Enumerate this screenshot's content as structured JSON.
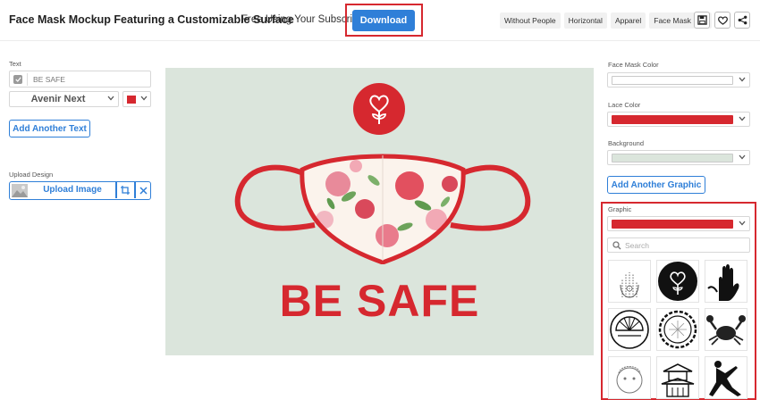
{
  "header": {
    "title": "Face Mask Mockup Featuring a Customizable Surface",
    "free_text": "Free Using Your Subscription!",
    "download_label": "Download",
    "tags": [
      "Without People",
      "Horizontal",
      "Apparel",
      "Face Mask"
    ],
    "icons": [
      "save-icon",
      "heart-icon",
      "share-icon"
    ]
  },
  "left_panel": {
    "text_label": "Text",
    "text_value": "BE SAFE",
    "font": "Avenir Next",
    "text_color": "#d6282f",
    "add_text_label": "Add Another Text",
    "upload_label": "Upload Design",
    "upload_button_label": "Upload Image"
  },
  "canvas": {
    "headline": "BE SAFE",
    "background_color": "#dbe5dc",
    "accent_color": "#d6282f"
  },
  "right_panel": {
    "mask_color_label": "Face Mask Color",
    "mask_color": "#ffffff",
    "lace_color_label": "Lace Color",
    "lace_color": "#d6282f",
    "background_label": "Background",
    "background_color": "#dbe5dc",
    "add_graphic_label": "Add Another Graphic",
    "graphic_label": "Graphic",
    "graphic_color": "#d6282f",
    "search_placeholder": "Search",
    "graphic_tiles": [
      "hand-sketch-graphic",
      "heart-flower-circle-graphic",
      "hand-silhouette-graphic",
      "fan-circle-graphic",
      "circle-badge-graphic",
      "crab-graphic",
      "sketch-face-graphic",
      "pagoda-graphic",
      "ninja-silhouette-graphic"
    ]
  }
}
